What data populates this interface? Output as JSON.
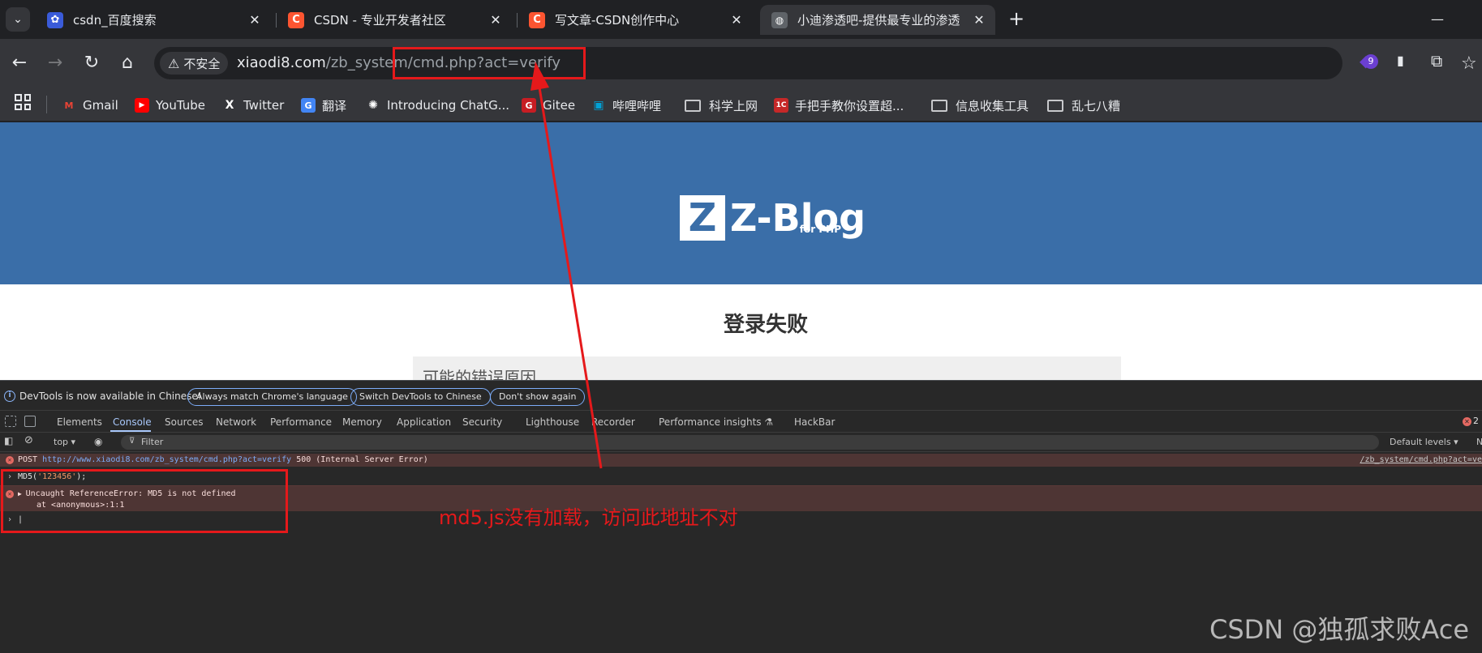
{
  "tabs": [
    {
      "title": "csdn_百度搜索",
      "favicon": "baidu-paw-icon",
      "color": "#3a5bd9"
    },
    {
      "title": "CSDN - 专业开发者社区",
      "favicon": "csdn-icon",
      "letter": "C",
      "color": "#fc5531"
    },
    {
      "title": "写文章-CSDN创作中心",
      "favicon": "csdn-icon",
      "letter": "C",
      "color": "#fc5531"
    },
    {
      "title": "小迪渗透吧-提供最专业的渗透",
      "favicon": "globe-icon",
      "color": "#5f6368"
    }
  ],
  "toolbar": {
    "security_label": "不安全",
    "url_host": "xiaodi8.com",
    "url_path": "/zb_system/cmd.php?act=verify",
    "extension_badge": "9"
  },
  "bookmarks": [
    {
      "label": "Gmail",
      "icon": "gmail-icon"
    },
    {
      "label": "YouTube",
      "icon": "youtube-icon"
    },
    {
      "label": "Twitter",
      "icon": "x-icon"
    },
    {
      "label": "翻译",
      "icon": "translate-icon"
    },
    {
      "label": "Introducing ChatG...",
      "icon": "openai-icon"
    },
    {
      "label": "Gitee",
      "icon": "gitee-icon"
    },
    {
      "label": "哔哩哔哩",
      "icon": "bilibili-icon"
    },
    {
      "label": "科学上网",
      "icon": "folder-icon"
    },
    {
      "label": "手把手教你设置超...",
      "icon": "bookmark-icon"
    },
    {
      "label": "信息收集工具",
      "icon": "folder-icon"
    },
    {
      "label": "乱七八糟",
      "icon": "folder-icon"
    }
  ],
  "page": {
    "logo_letter": "Z",
    "logo_text": "Z-Blog",
    "logo_sub": "for PHP",
    "heading": "登录失败",
    "error_reason_label": "可能的错误原因"
  },
  "devtools": {
    "info_message": "DevTools is now available in Chinese!",
    "info_buttons": [
      "Always match Chrome's language",
      "Switch DevTools to Chinese",
      "Don't show again"
    ],
    "tabs": [
      "Elements",
      "Console",
      "Sources",
      "Network",
      "Performance",
      "Memory",
      "Application",
      "Security",
      "Lighthouse",
      "Recorder",
      "Performance insights ⚗",
      "HackBar"
    ],
    "active_tab": "Console",
    "error_count": "2",
    "context": "top ▾",
    "filter_placeholder": "Filter",
    "levels": "Default levels ▾",
    "levels_more": "N",
    "console": {
      "post_error_method": "POST",
      "post_error_url": "http://www.xiaodi8.com/zb_system/cmd.php?act=verify",
      "post_error_status": "500 (Internal Server Error)",
      "post_error_source": "/zb_system/cmd.php?act=ve",
      "input_prefix": "MD5(",
      "input_string": "'123456'",
      "input_suffix": ");",
      "ref_error": "Uncaught ReferenceError: MD5 is not defined",
      "ref_error_at": "at <anonymous>:1:1"
    }
  },
  "annotation": "md5.js没有加载，访问此地址不对",
  "watermark": "CSDN @独孤求败Ace",
  "colors": {
    "accent_red": "#e5191b",
    "zblog_blue": "#3a6ea8"
  }
}
